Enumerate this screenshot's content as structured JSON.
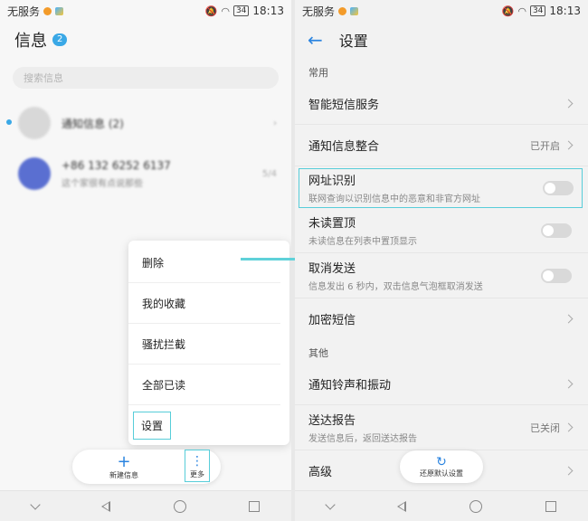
{
  "status": {
    "carrier": "无服务",
    "battery": "34",
    "time": "18:13"
  },
  "left": {
    "title": "信息",
    "badge": "2",
    "search_placeholder": "搜索信息",
    "conversations": [
      {
        "name": "通知信息 (2)",
        "sub": "",
        "time": ""
      },
      {
        "name": "+86 132 6252 6137",
        "sub": "这个家很有点说那些",
        "time": "5/4"
      }
    ],
    "menu": [
      "删除",
      "我的收藏",
      "骚扰拦截",
      "全部已读",
      "设置"
    ],
    "bottom": {
      "new_label": "新建信息",
      "more_label": "更多"
    }
  },
  "right": {
    "title": "设置",
    "sections": {
      "common": "常用",
      "other": "其他"
    },
    "rows": {
      "smart_sms": {
        "title": "智能短信服务"
      },
      "notif_merge": {
        "title": "通知信息整合",
        "value": "已开启"
      },
      "url_detect": {
        "title": "网址识别",
        "sub": "联网查询以识别信息中的恶意和非官方网址"
      },
      "unread_top": {
        "title": "未读置顶",
        "sub": "未读信息在列表中置顶显示"
      },
      "cancel_send": {
        "title": "取消发送",
        "sub": "信息发出 6 秒内，双击信息气泡框取消发送"
      },
      "encrypted": {
        "title": "加密短信"
      },
      "ringtone": {
        "title": "通知铃声和振动"
      },
      "delivery": {
        "title": "送达报告",
        "sub": "发送信息后，返回送达报告",
        "value": "已关闭"
      },
      "advanced": {
        "title": "高级"
      }
    },
    "restore_label": "还原默认设置"
  },
  "colors": {
    "accent": "#2b84e0",
    "highlight": "#57cdd9",
    "badge": "#3aa8e6"
  }
}
